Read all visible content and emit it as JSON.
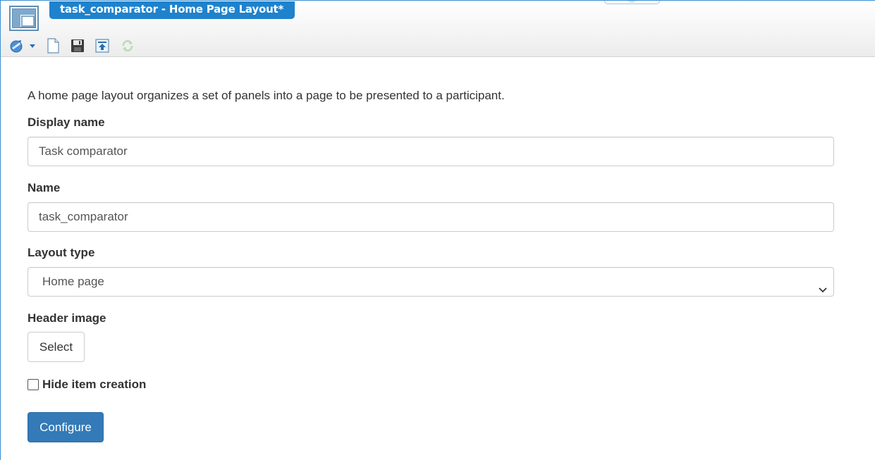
{
  "window": {
    "title": "task_comparator - Home Page Layout*"
  },
  "toolbar": {
    "icons": [
      "wizard-icon",
      "dropdown-arrow-icon",
      "new-document-icon",
      "save-icon",
      "publish-icon",
      "refresh-icon"
    ]
  },
  "form": {
    "intro": "A home page layout organizes a set of panels into a page to be presented to a participant.",
    "display_name": {
      "label": "Display name",
      "value": "Task comparator"
    },
    "name": {
      "label": "Name",
      "value": "task_comparator"
    },
    "layout_type": {
      "label": "Layout type",
      "selected": "Home page"
    },
    "header_image": {
      "label": "Header image",
      "button_label": "Select"
    },
    "hide_item_creation": {
      "label": "Hide item creation",
      "checked": false
    },
    "configure_label": "Configure"
  },
  "colors": {
    "accent": "#1f82cc",
    "primary_button": "#337ab7",
    "text": "#333333",
    "border": "#cccccc"
  }
}
